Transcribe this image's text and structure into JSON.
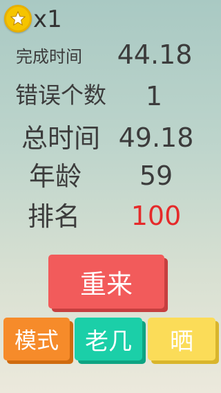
{
  "header": {
    "star_count": "x1",
    "star_icon": "star-icon"
  },
  "stats": {
    "finish_time_label": "完成时间",
    "finish_time_value": "44.18",
    "errors_label": "错误个数",
    "errors_value": "1",
    "total_time_label": "总时间",
    "total_time_value": "49.18",
    "age_label": "年龄",
    "age_value": "59",
    "rank_label": "排名",
    "rank_value": "100"
  },
  "buttons": {
    "retry": "重来",
    "mode": "模式",
    "laoji": "老几",
    "share": "晒"
  },
  "colors": {
    "rank_value": "#e52a2a",
    "retry": "#f25b5b",
    "mode": "#f68b2a",
    "laoji": "#1bcfa8",
    "share": "#fbdc58"
  }
}
